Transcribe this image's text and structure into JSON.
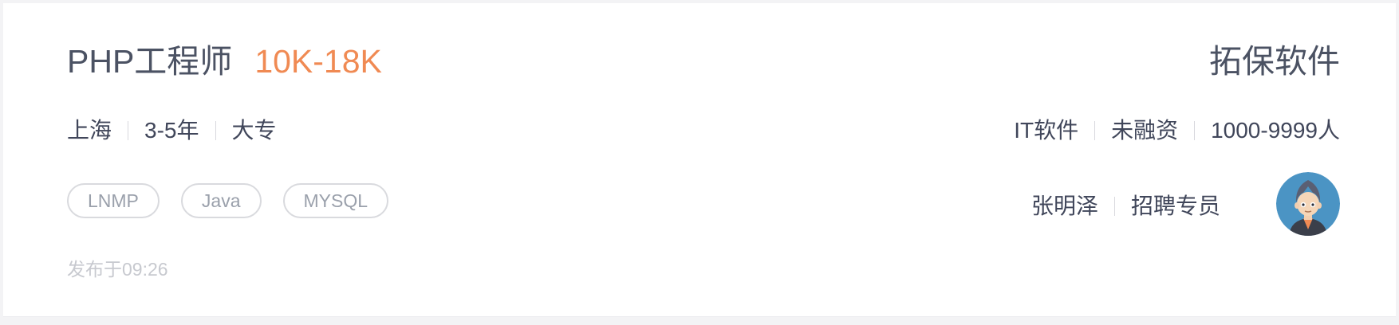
{
  "job": {
    "title": "PHP工程师",
    "salary": "10K-18K",
    "location": "上海",
    "experience": "3-5年",
    "education": "大专",
    "tags": [
      "LNMP",
      "Java",
      "MYSQL"
    ],
    "published": "发布于09:26"
  },
  "company": {
    "name": "拓保软件",
    "industry": "IT软件",
    "funding": "未融资",
    "size": "1000-9999人"
  },
  "recruiter": {
    "name": "张明泽",
    "role": "招聘专员",
    "avatar_icon": "recruiter-avatar-icon"
  },
  "colors": {
    "salary": "#f08a53",
    "title": "#4b5263",
    "tag_border": "#d9dade",
    "avatar_bg": "#4b94c4"
  }
}
